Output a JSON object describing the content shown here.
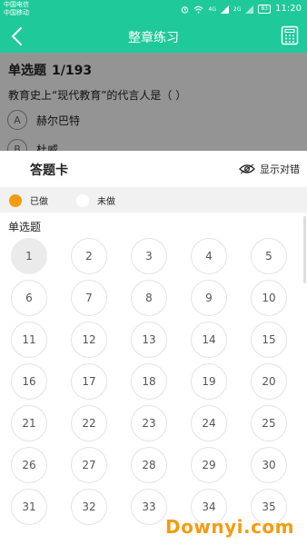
{
  "status_bar": {
    "carrier_1": "中国电信",
    "carrier_2": "中国移动",
    "network_1": "4G",
    "network_2": "2G",
    "battery": "83",
    "time": "11:20"
  },
  "header": {
    "title": "整章练习",
    "back_icon": "chevron-left-icon",
    "calculator_icon": "calculator-icon"
  },
  "question": {
    "type": "单选题",
    "counter": "1/193",
    "text": "教育史上“现代教育”的代言人是（  ）",
    "options": [
      {
        "letter": "A",
        "text": "赫尔巴特"
      },
      {
        "letter": "B",
        "text": "杜威"
      }
    ]
  },
  "answer_sheet": {
    "title": "答题卡",
    "show_errors_label": "显示对错",
    "legend_done": "已做",
    "legend_undone": "未做",
    "section_label": "单选题",
    "numbers": [
      "1",
      "2",
      "3",
      "4",
      "5",
      "6",
      "7",
      "8",
      "9",
      "10",
      "11",
      "12",
      "13",
      "14",
      "15",
      "16",
      "17",
      "18",
      "19",
      "20",
      "21",
      "22",
      "23",
      "24",
      "25",
      "26",
      "27",
      "28",
      "29",
      "30",
      "31",
      "32",
      "33",
      "34",
      "35"
    ],
    "active_number": "1"
  },
  "colors": {
    "accent": "#1fc99a",
    "done": "#f39c12"
  },
  "watermark": "Downyi.com"
}
